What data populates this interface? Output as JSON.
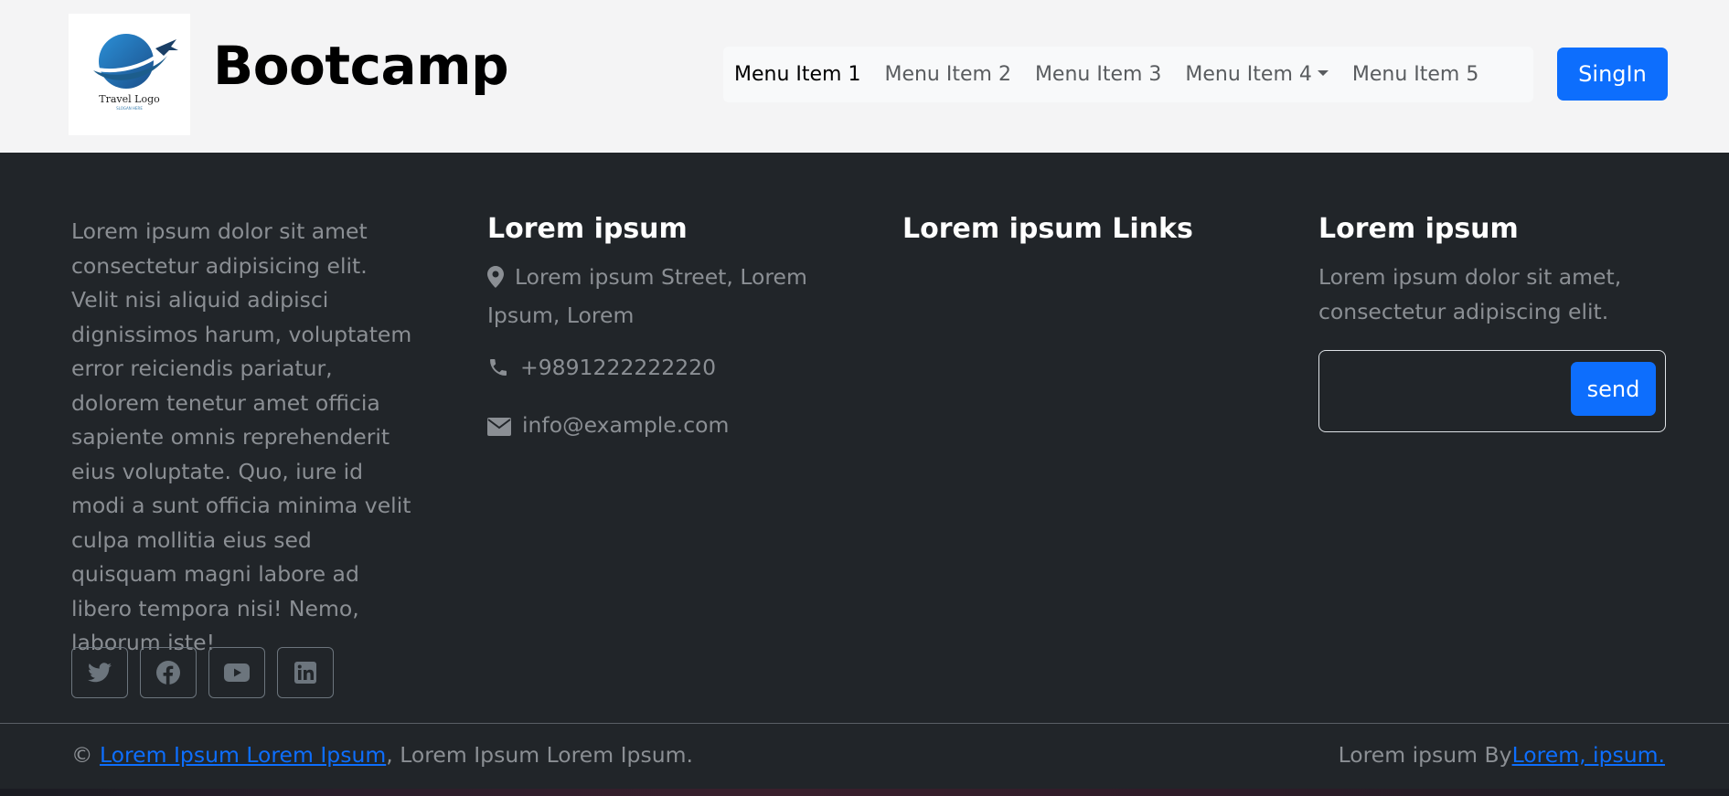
{
  "header": {
    "logo": {
      "text": "Travel Logo",
      "subtext": "SLOGAN HERE"
    },
    "brand": "Bootcamp",
    "nav": [
      {
        "label": "Menu Item 1",
        "active": true
      },
      {
        "label": "Menu Item 2"
      },
      {
        "label": "Menu Item 3"
      },
      {
        "label": "Menu Item 4",
        "dropdown": true
      },
      {
        "label": "Menu Item 5"
      }
    ],
    "signin_label": "SingIn"
  },
  "footer": {
    "about_text": "Lorem ipsum dolor sit amet consectetur adipisicing elit. Velit nisi aliquid adipisci dignissimos harum, voluptatem error reiciendis pariatur, dolorem tenetur amet officia sapiente omnis reprehenderit eius voluptate. Quo, iure id modi a sunt officia minima velit culpa mollitia eius sed quisquam magni labore ad libero tempora nisi! Nemo, laborum iste!",
    "socials": [
      "twitter-icon",
      "facebook-icon",
      "youtube-icon",
      "linkedin-icon"
    ],
    "contact": {
      "title": "Lorem ipsum",
      "address": "Lorem ipsum Street, Lorem Ipsum, Lorem",
      "phone": "+9891222222220",
      "email": "info@example.com"
    },
    "links": {
      "title": "Lorem ipsum Links"
    },
    "newsletter": {
      "title": "Lorem ipsum",
      "text": "Lorem ipsum dolor sit amet, consectetur adipiscing elit.",
      "input_value": "",
      "send_label": "send"
    },
    "bottom": {
      "copyright_symbol": "©",
      "copyright_link": "Lorem Ipsum Lorem Ipsum",
      "copyright_rest": ", Lorem Ipsum Lorem Ipsum.",
      "by_text": "Lorem ipsum By",
      "by_link": "Lorem, ipsum."
    }
  },
  "colors": {
    "primary": "#0d6efd",
    "footer_bg": "#212529",
    "header_bg": "#f4f4f5",
    "muted_text": "#8b8f94"
  }
}
